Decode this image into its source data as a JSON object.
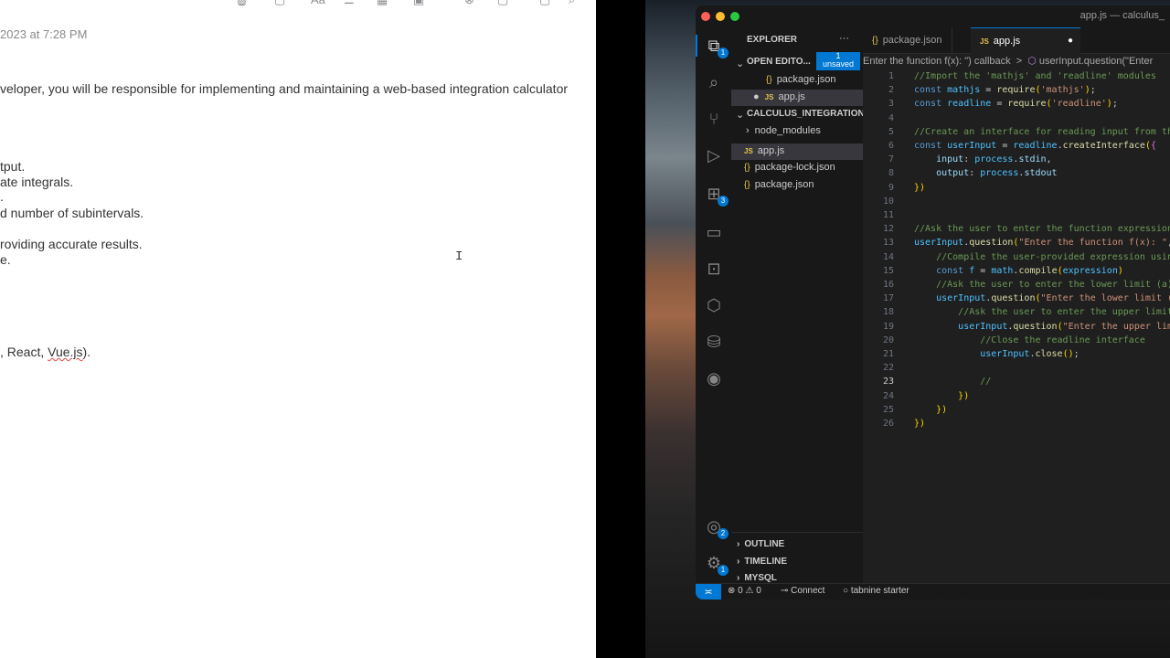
{
  "notes": {
    "date": "2023 at 7:28 PM",
    "lines": [
      "veloper, you will be responsible for implementing and maintaining a web-based integration calculator",
      "tput.",
      "ate integrals.",
      ".",
      "d number of subintervals.",
      "roviding accurate results.",
      "e.",
      ", React, ",
      "Vue.js",
      ")."
    ],
    "toolbar_icons": [
      "trash-icon",
      "compose-icon",
      "format-icon",
      "checklist-icon",
      "table-icon",
      "media-icon",
      "share-link-icon",
      "lock-icon",
      "sidebar-icon",
      "search-icon"
    ]
  },
  "window": {
    "title": "app.js — calculus_"
  },
  "activity_bar": {
    "explorer_badge": "1",
    "extensions_badge": "3",
    "accounts_badge": "2",
    "settings_badge": "1"
  },
  "sidebar": {
    "title": "EXPLORER",
    "more": "···",
    "open_editors": "OPEN EDITO...",
    "unsaved_count": "1",
    "unsaved_label": "unsaved",
    "open_files": [
      {
        "name": "package.json",
        "type": "json"
      },
      {
        "name": "app.js",
        "type": "js",
        "modified": true
      }
    ],
    "project": "CALCULUS_INTEGRATION",
    "tree": [
      {
        "name": "node_modules",
        "type": "folder"
      },
      {
        "name": "app.js",
        "type": "js",
        "selected": true
      },
      {
        "name": "package-lock.json",
        "type": "json"
      },
      {
        "name": "package.json",
        "type": "json"
      }
    ],
    "panels": [
      "OUTLINE",
      "TIMELINE",
      "MYSQL"
    ]
  },
  "tabs": [
    {
      "label": "package.json",
      "type": "json",
      "active": false
    },
    {
      "label": "app.js",
      "type": "js",
      "active": true,
      "dirty": true
    }
  ],
  "breadcrumbs": {
    "part1": "Enter the function f(x): \") callback",
    "sep": ">",
    "part2": "userInput.question(\"Enter"
  },
  "code": {
    "current_line": 23,
    "lines": [
      "//Import the 'mathjs' and 'readline' modules",
      "const mathjs = require('mathjs');",
      "const readline = require('readline');",
      "",
      "//Create an interface for reading input from the user",
      "const userInput = readline.createInterface({",
      "    input: process.stdin,",
      "    output: process.stdout",
      "})",
      "",
      "",
      "//Ask the user to enter the function expression",
      "userInput.question(\"Enter the function f(x): \", (expression) => {",
      "    //Compile the user-provided expression using mathjs",
      "    const f = math.compile(expression)",
      "    //Ask the user to enter the lower limit (a)",
      "    userInput.question(\"Enter the lower limit (a): \", (a) => {",
      "        //Ask the user to enter the upper limit (b)",
      "        userInput.question(\"Enter the upper limit (b): \", (b) => {",
      "            //Close the readline interface",
      "            userInput.close();",
      "",
      "            //",
      "        })",
      "    })",
      "})"
    ]
  },
  "statusbar": {
    "remote_icon": "remote-icon",
    "errors": "0",
    "warnings": "0",
    "connect": "Connect",
    "tabnine": "tabnine starter"
  },
  "colors": {
    "accent": "#0078d4",
    "editor_bg": "#1f1f1f",
    "sidebar_bg": "#181818"
  }
}
